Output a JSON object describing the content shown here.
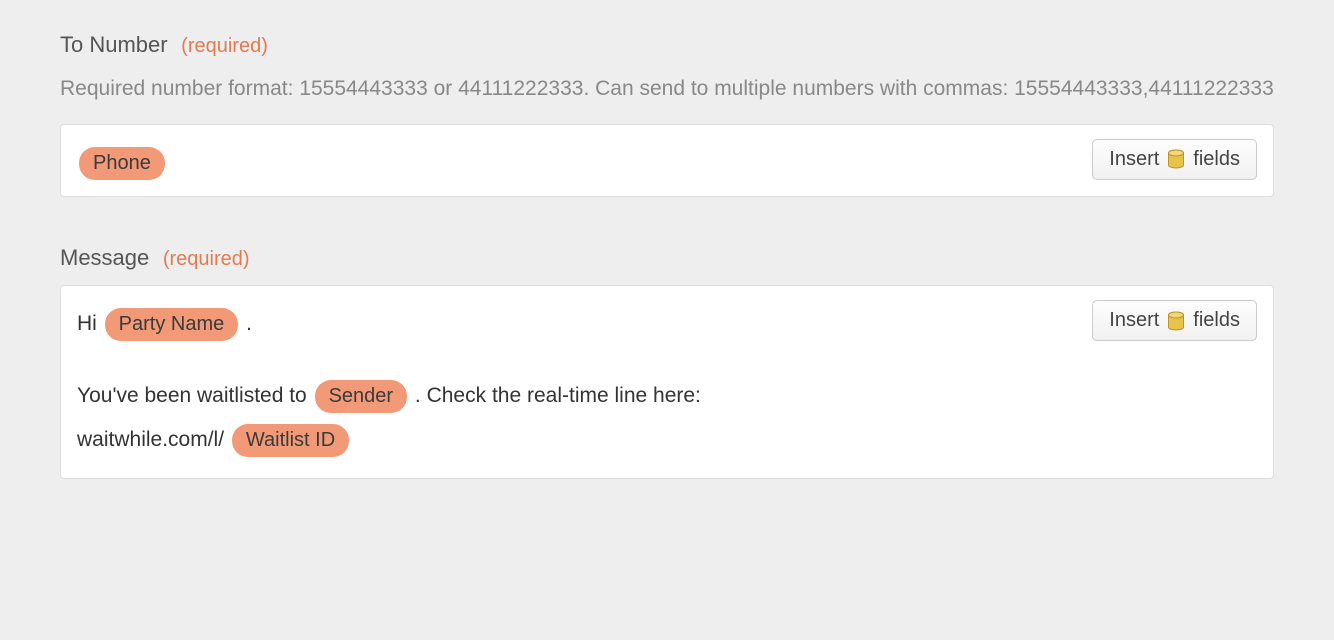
{
  "to_number": {
    "label": "To Number",
    "required_tag": "(required)",
    "help": "Required number format: 15554443333 or 44111222333. Can send to multiple numbers with commas: 15554443333,44111222333",
    "pills": {
      "phone": "Phone"
    },
    "insert_button": {
      "prefix": "Insert",
      "suffix": "fields"
    }
  },
  "message": {
    "label": "Message",
    "required_tag": "(required)",
    "segments": {
      "s1": "Hi ",
      "pill_party": "Party Name",
      "s2": " .",
      "s3": "You've been waitlisted to ",
      "pill_sender": "Sender",
      "s4": " .  Check the real-time line here:",
      "s5": "waitwhile.com/l/ ",
      "pill_waitlist": "Waitlist ID"
    },
    "insert_button": {
      "prefix": "Insert",
      "suffix": "fields"
    }
  }
}
